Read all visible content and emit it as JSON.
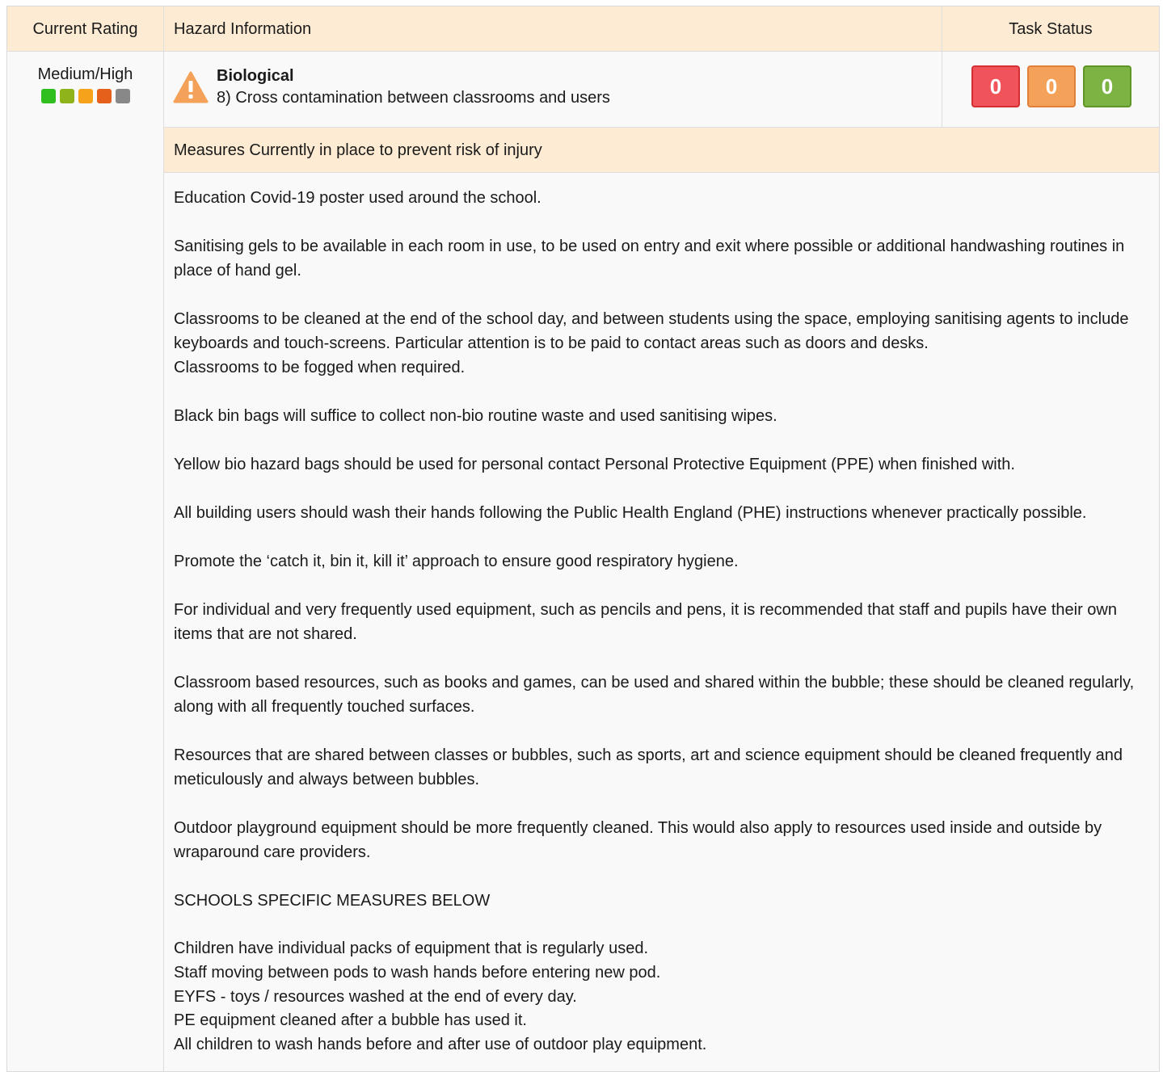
{
  "header": {
    "current_rating": "Current Rating",
    "hazard_information": "Hazard Information",
    "task_status": "Task Status"
  },
  "rating": {
    "label": "Medium/High",
    "dot_colors": [
      "#2fbf1f",
      "#8fb31a",
      "#f7a21b",
      "#e5601a",
      "#888888"
    ]
  },
  "hazard": {
    "icon": "warning-triangle-icon",
    "title": "Biological",
    "description": "8) Cross contamination between classrooms and users"
  },
  "task_counts": {
    "red": "0",
    "orange": "0",
    "green": "0"
  },
  "measures": {
    "heading": "Measures Currently in place to prevent risk of injury",
    "paragraphs": [
      "Education Covid-19 poster used around the school.",
      "Sanitising gels to be available in each room in use, to be used on entry and exit where possible or additional handwashing routines in place of hand gel.",
      "Classrooms to be cleaned at the end of the school day, and between students using the space, employing sanitising agents to include keyboards and touch-screens. Particular attention is to be paid to contact areas such as doors and desks.",
      "Classrooms to be fogged when required.",
      "Black bin bags will suffice to collect non-bio routine waste and used sanitising wipes.",
      "Yellow bio hazard bags should be used for personal contact Personal Protective Equipment (PPE) when finished with.",
      "All building users should wash their hands following the Public Health England (PHE) instructions whenever practically possible.",
      "Promote the ‘catch it, bin it, kill it’ approach to ensure good respiratory hygiene.",
      "For individual and very frequently used equipment, such as pencils and pens, it is recommended that staff and pupils have their own items that are not shared.",
      "Classroom based resources, such as books and games, can be used and shared within the bubble; these should be cleaned regularly, along with all frequently touched surfaces.",
      "Resources that are shared between classes or bubbles, such as sports, art and science equipment should be cleaned frequently and meticulously and always between bubbles.",
      "Outdoor playground equipment should be more frequently cleaned. This would also apply to resources used inside and outside by wraparound care providers.",
      "SCHOOLS SPECIFIC MEASURES BELOW"
    ],
    "school_lines": [
      "Children have individual packs of equipment that is regularly used.",
      "Staff moving between pods to wash hands before entering new pod.",
      "EYFS - toys / resources washed at the end of every day.",
      "PE equipment cleaned after a bubble has used it.",
      "All children to wash hands before and after use of outdoor play equipment."
    ]
  }
}
